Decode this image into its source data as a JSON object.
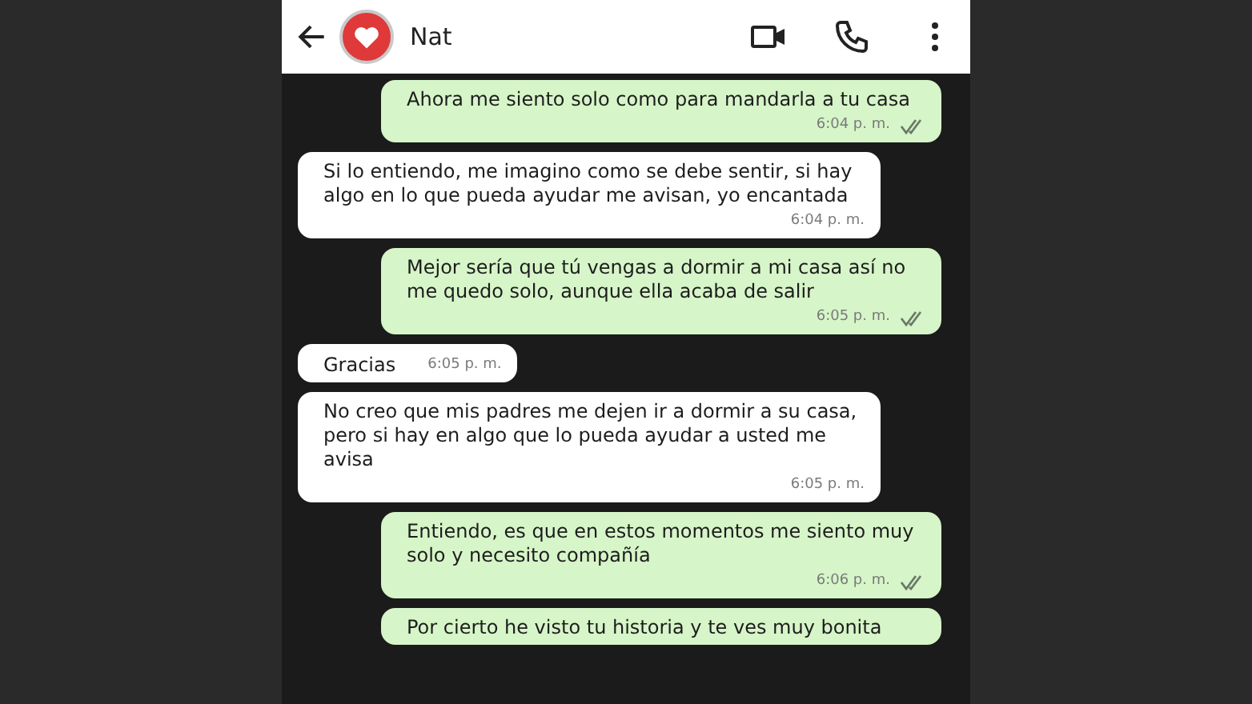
{
  "header": {
    "contact_name": "Nat"
  },
  "messages": [
    {
      "kind": "outgoing",
      "text": "Ahora me siento solo como para mandarla a tu casa",
      "time": "6:04 p. m.",
      "read": true
    },
    {
      "kind": "incoming",
      "text": "Si lo entiendo, me imagino como se debe sentir, si hay algo en lo que pueda ayudar me avisan, yo encantada",
      "time": "6:04 p. m."
    },
    {
      "kind": "outgoing",
      "text": "Mejor sería que tú vengas a dormir a mi casa así no me quedo solo, aunque ella acaba de salir",
      "time": "6:05 p. m.",
      "read": true
    },
    {
      "kind": "incoming",
      "text": "Gracias",
      "time": "6:05 p. m."
    },
    {
      "kind": "incoming",
      "text": "No creo que mis padres me dejen ir a dormir a su casa, pero si hay en algo que lo pueda ayudar a usted me avisa",
      "time": "6:05 p. m."
    },
    {
      "kind": "outgoing",
      "text": "Entiendo, es que en estos momentos me siento muy solo y necesito compañía",
      "time": "6:06 p. m.",
      "read": true
    },
    {
      "kind": "outgoing",
      "text": "Por cierto he visto tu historia y te ves muy bonita"
    }
  ]
}
